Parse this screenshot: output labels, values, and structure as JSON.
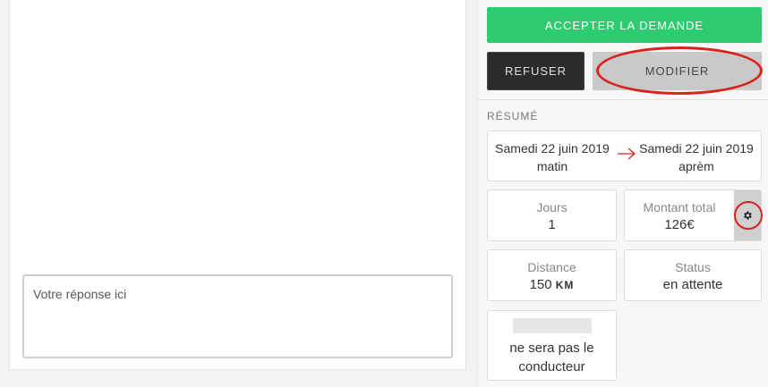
{
  "reply": {
    "placeholder": "Votre réponse ici"
  },
  "actions": {
    "accept_label": "ACCEPTER LA DEMANDE",
    "refuse_label": "REFUSER",
    "modify_label": "MODIFIER"
  },
  "summary": {
    "section_label": "RÉSUMÉ",
    "date_from": {
      "day": "Samedi 22 juin 2019",
      "period": "matin"
    },
    "date_to": {
      "day": "Samedi 22 juin 2019",
      "period": "aprèm"
    },
    "jours": {
      "label": "Jours",
      "value": "1"
    },
    "montant": {
      "label": "Montant total",
      "value": "126€"
    },
    "distance": {
      "label": "Distance",
      "value": "150",
      "unit": "KM"
    },
    "status": {
      "label": "Status",
      "value": "en attente"
    },
    "driver_note": "ne sera pas le conducteur"
  },
  "colors": {
    "accept": "#2ecc71",
    "refuse": "#2b2b2b",
    "modify": "#c9c9c9",
    "highlight": "#d9231d"
  },
  "icons": {
    "arrow": "arrow-right-icon",
    "gear": "gear-icon"
  }
}
